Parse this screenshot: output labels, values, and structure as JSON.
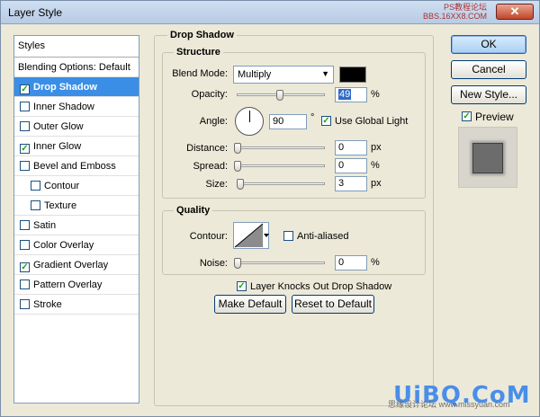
{
  "window": {
    "title": "Layer Style",
    "watermark_line1": "PS教程论坛",
    "watermark_line2": "BBS.16XX8.COM"
  },
  "styles_panel": {
    "header": "Styles",
    "items": [
      {
        "label": "Blending Options: Default",
        "checkbox": false,
        "checked": false,
        "selected": false,
        "indent": false
      },
      {
        "label": "Drop Shadow",
        "checkbox": true,
        "checked": true,
        "selected": true,
        "indent": false
      },
      {
        "label": "Inner Shadow",
        "checkbox": true,
        "checked": false,
        "selected": false,
        "indent": false
      },
      {
        "label": "Outer Glow",
        "checkbox": true,
        "checked": false,
        "selected": false,
        "indent": false
      },
      {
        "label": "Inner Glow",
        "checkbox": true,
        "checked": true,
        "selected": false,
        "indent": false
      },
      {
        "label": "Bevel and Emboss",
        "checkbox": true,
        "checked": false,
        "selected": false,
        "indent": false
      },
      {
        "label": "Contour",
        "checkbox": true,
        "checked": false,
        "selected": false,
        "indent": true
      },
      {
        "label": "Texture",
        "checkbox": true,
        "checked": false,
        "selected": false,
        "indent": true
      },
      {
        "label": "Satin",
        "checkbox": true,
        "checked": false,
        "selected": false,
        "indent": false
      },
      {
        "label": "Color Overlay",
        "checkbox": true,
        "checked": false,
        "selected": false,
        "indent": false
      },
      {
        "label": "Gradient Overlay",
        "checkbox": true,
        "checked": true,
        "selected": false,
        "indent": false
      },
      {
        "label": "Pattern Overlay",
        "checkbox": true,
        "checked": false,
        "selected": false,
        "indent": false
      },
      {
        "label": "Stroke",
        "checkbox": true,
        "checked": false,
        "selected": false,
        "indent": false
      }
    ]
  },
  "drop_shadow": {
    "title": "Drop Shadow",
    "structure": {
      "title": "Structure",
      "blend_mode_label": "Blend Mode:",
      "blend_mode_value": "Multiply",
      "shadow_color": "#000000",
      "opacity_label": "Opacity:",
      "opacity_value": "49",
      "opacity_level": 49,
      "opacity_unit": "%",
      "angle_label": "Angle:",
      "angle_value": "90",
      "angle_unit": "°",
      "use_global_light_label": "Use Global Light",
      "use_global_light_checked": true,
      "distance_label": "Distance:",
      "distance_value": "0",
      "distance_unit": "px",
      "spread_label": "Spread:",
      "spread_value": "0",
      "spread_unit": "%",
      "size_label": "Size:",
      "size_value": "3",
      "size_unit": "px"
    },
    "quality": {
      "title": "Quality",
      "contour_label": "Contour:",
      "anti_aliased_label": "Anti-aliased",
      "anti_aliased_checked": false,
      "noise_label": "Noise:",
      "noise_value": "0",
      "noise_unit": "%"
    },
    "knockout_label": "Layer Knocks Out Drop Shadow",
    "knockout_checked": true,
    "make_default_label": "Make Default",
    "reset_default_label": "Reset to Default"
  },
  "actions": {
    "ok_label": "OK",
    "cancel_label": "Cancel",
    "new_style_label": "New Style...",
    "preview_label": "Preview",
    "preview_checked": true
  },
  "branding": {
    "logo": "UiBQ.CoM",
    "logo_sub": "思缘设计论坛 www.missyuan.com"
  }
}
